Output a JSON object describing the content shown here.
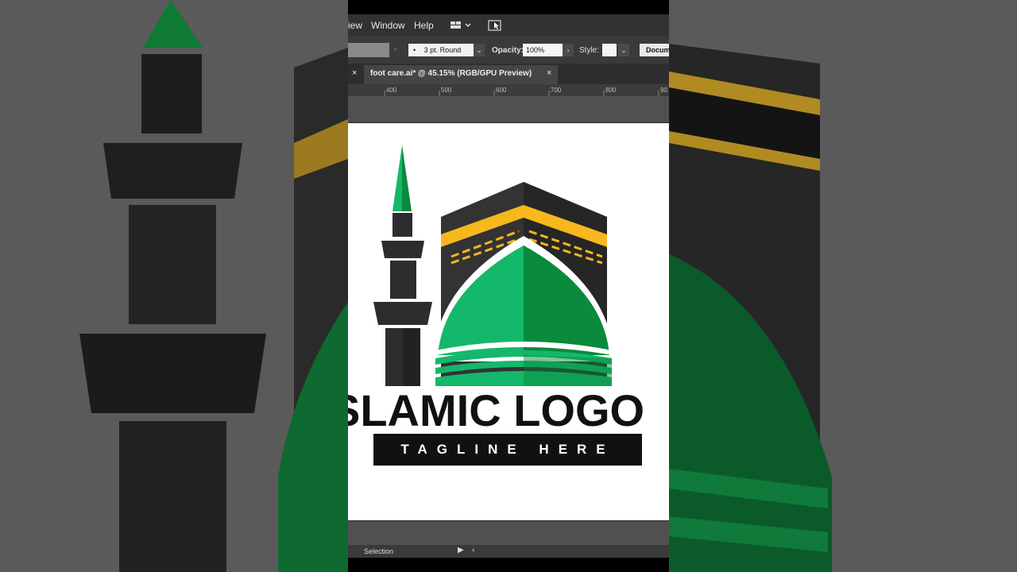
{
  "menubar": {
    "items": [
      "iew",
      "Window",
      "Help"
    ]
  },
  "control_bar": {
    "stroke_profile": "3 pt. Round",
    "opacity_label": "Opacity:",
    "opacity_value": "100%",
    "style_label": "Style:",
    "document_button": "Docum"
  },
  "document_tab": {
    "title": "foot care.ai* @ 45.15% (RGB/GPU Preview)",
    "close_icon": "×"
  },
  "ruler": {
    "ticks": [
      "400",
      "500",
      "600",
      "700",
      "800",
      "90"
    ]
  },
  "artwork": {
    "title": "SLAMIC LOGO",
    "tagline": "TAGLINE HERE"
  },
  "status": {
    "tool": "Selection"
  },
  "colors": {
    "green_light": "#14b86a",
    "green_dark": "#0a8a3c",
    "gold": "#f6b81c",
    "kaaba": "#2f2f2f",
    "minaret": "#2d2d2d"
  }
}
